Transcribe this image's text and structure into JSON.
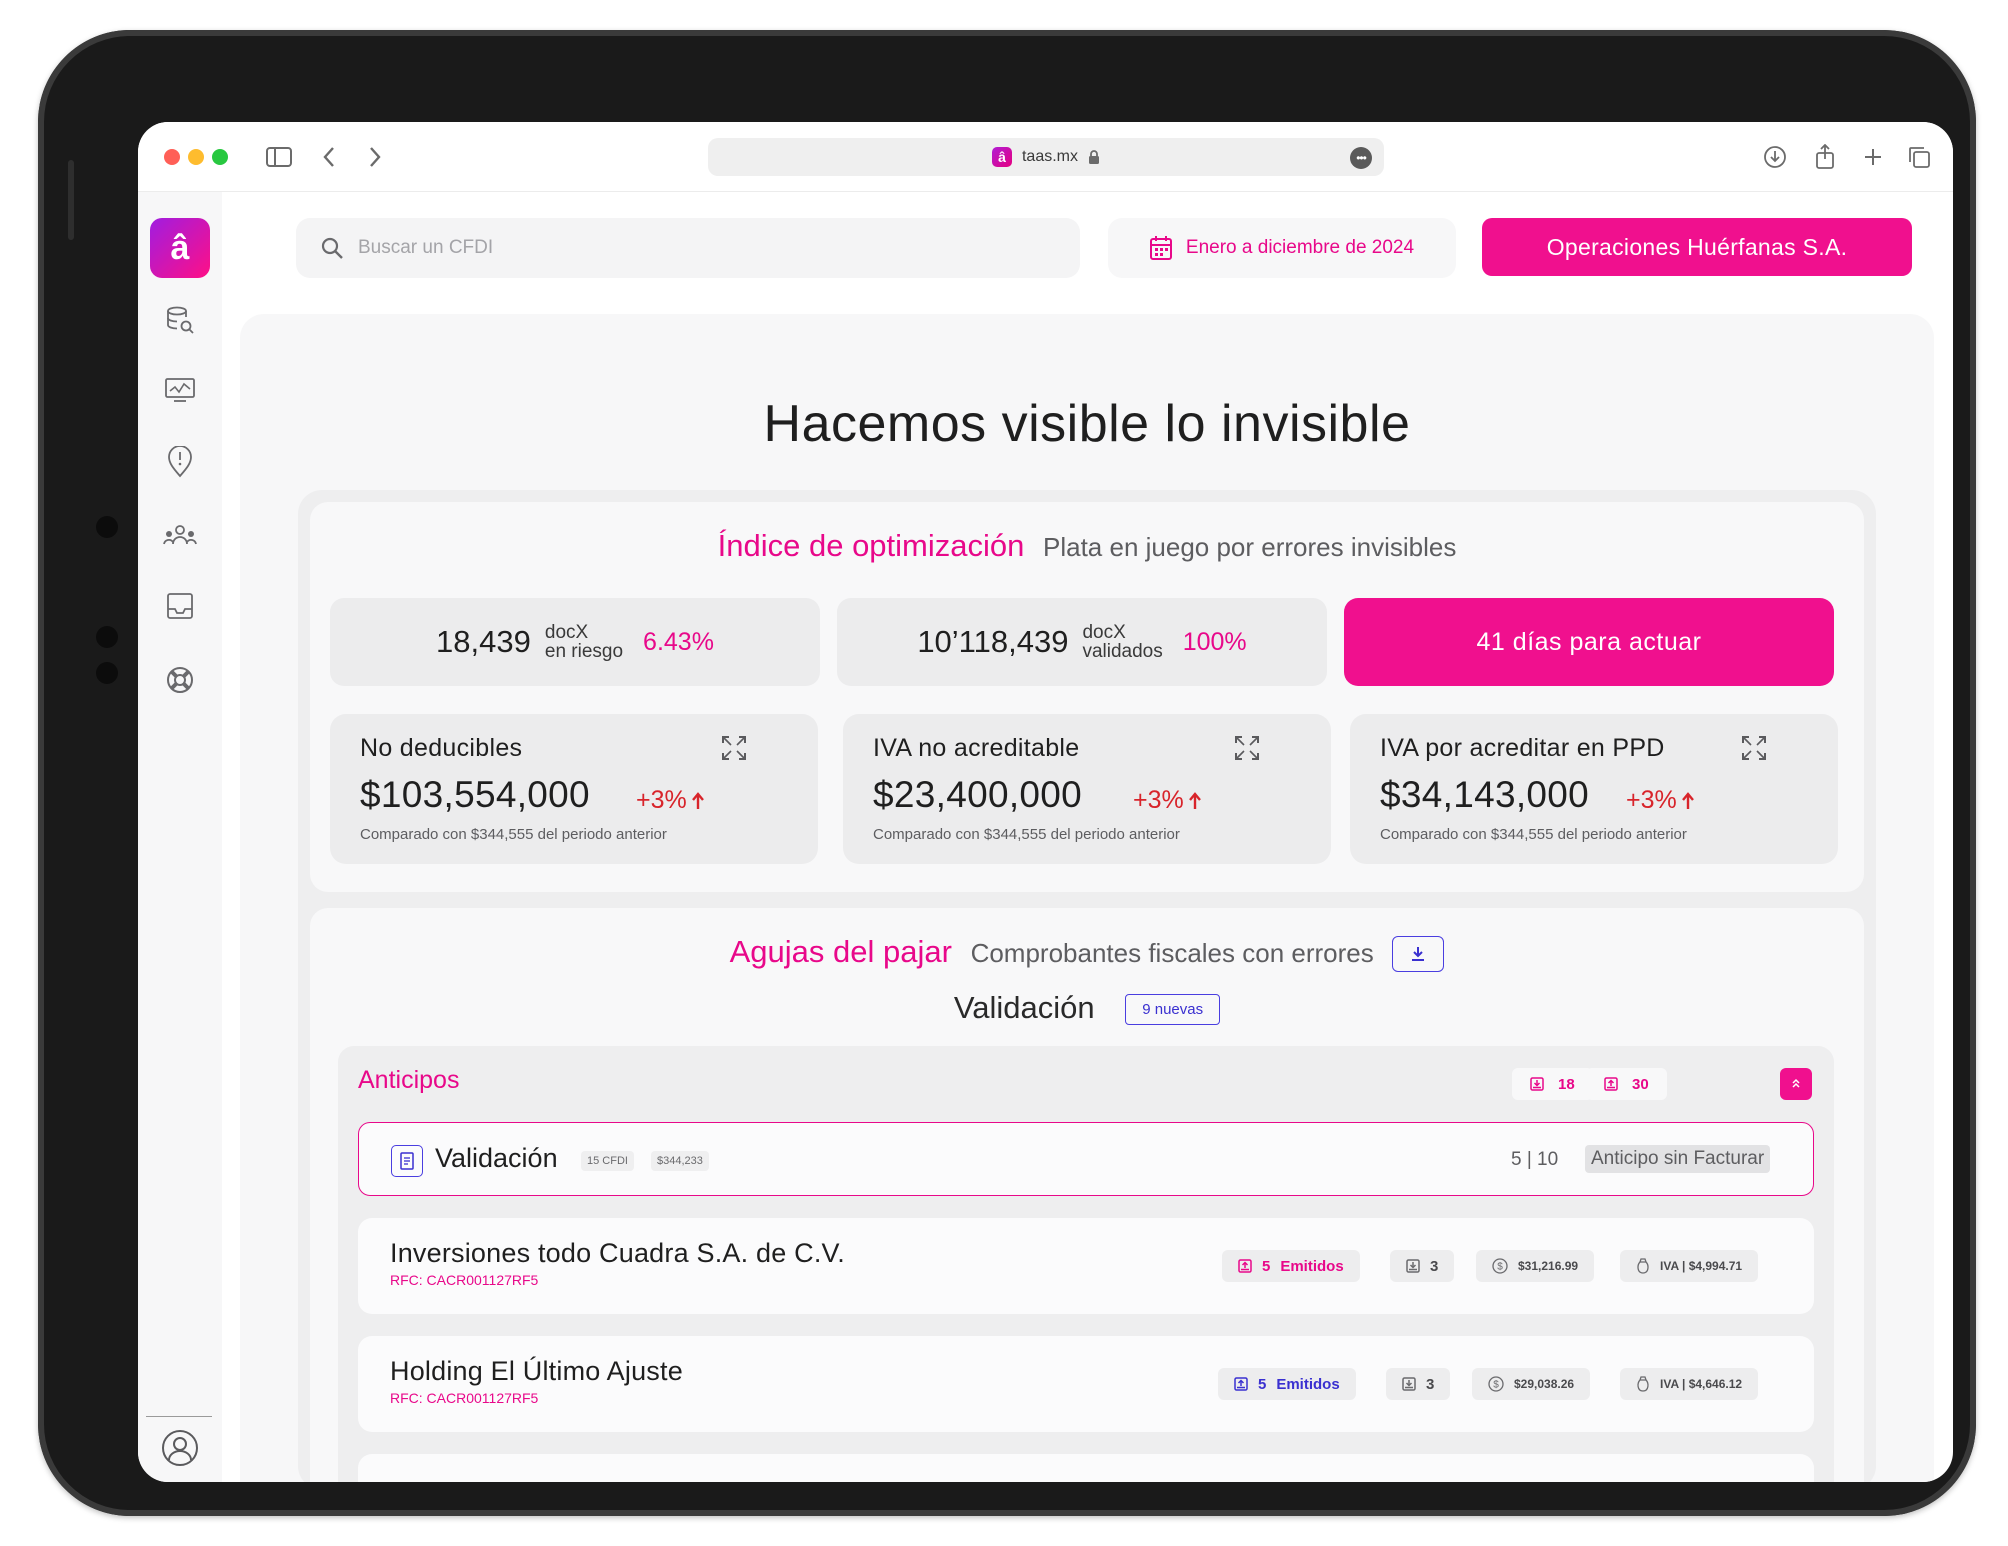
{
  "browser": {
    "url": "taas.mx",
    "favicon_letter": "â"
  },
  "app": {
    "logo_letter": "â",
    "accent": "#f0108e",
    "secondary_accent": "#4a3ee0",
    "sidebar": {
      "items": [
        {
          "icon": "database-search-icon"
        },
        {
          "icon": "monitor-chart-icon"
        },
        {
          "icon": "alert-shield-icon"
        },
        {
          "icon": "team-icon"
        },
        {
          "icon": "inbox-tray-icon"
        },
        {
          "icon": "lifebuoy-icon"
        }
      ],
      "footer_icon": "user-account-icon"
    },
    "topbar": {
      "search_placeholder": "Buscar un CFDI",
      "date_range": "Enero a diciembre de 2024",
      "company": "Operaciones Huérfanas S.A."
    }
  },
  "hero": "Hacemos visible lo invisible",
  "optimization": {
    "title": "Índice de optimización",
    "subtitle": "Plata en juego por errores invisibles",
    "stats": [
      {
        "value": "18,439",
        "label_top": "docX",
        "label_bottom": "en riesgo",
        "percent": "6.43%"
      },
      {
        "value": "10’118,439",
        "label_top": "docX",
        "label_bottom": "validados",
        "percent": "100%"
      }
    ],
    "cta": "41 días para actuar",
    "metrics": [
      {
        "title": "No deducibles",
        "value": "$103,554,000",
        "delta": "+3%",
        "note": "Comparado con $344,555 del periodo anterior"
      },
      {
        "title": "IVA no acreditable",
        "value": "$23,400,000",
        "delta": "+3%",
        "note": "Comparado con $344,555 del periodo anterior"
      },
      {
        "title": "IVA por acreditar en PPD",
        "value": "$34,143,000",
        "delta": "+3%",
        "note": "Comparado con $344,555 del periodo anterior"
      }
    ]
  },
  "needles": {
    "title": "Agujas del pajar",
    "subtitle": "Comprobantes fiscales con errores",
    "validation_label": "Validación",
    "new_badge": "9 nuevas",
    "group": {
      "title": "Anticipos",
      "chip_received": "18",
      "chip_issued": "30",
      "validation_card": {
        "title": "Validación",
        "cfdi_chip": "15 CFDI",
        "amount_chip": "$344,233",
        "ratio": "5 | 10",
        "tag": "Anticipo sin Facturar"
      },
      "rows": [
        {
          "name": "Inversiones todo Cuadra S.A. de C.V.",
          "rfc": "RFC: CACR001127RF5",
          "issued_count": "5",
          "issued_label": "Emitidos",
          "received_count": "3",
          "amount": "$31,216.99",
          "iva": "IVA | $4,994.71"
        },
        {
          "name": "Holding El Último Ajuste",
          "rfc": "RFC: CACR001127RF5",
          "issued_count": "5",
          "issued_label": "Emitidos",
          "received_count": "3",
          "amount": "$29,038.26",
          "iva": "IVA | $4,646.12"
        }
      ]
    }
  }
}
